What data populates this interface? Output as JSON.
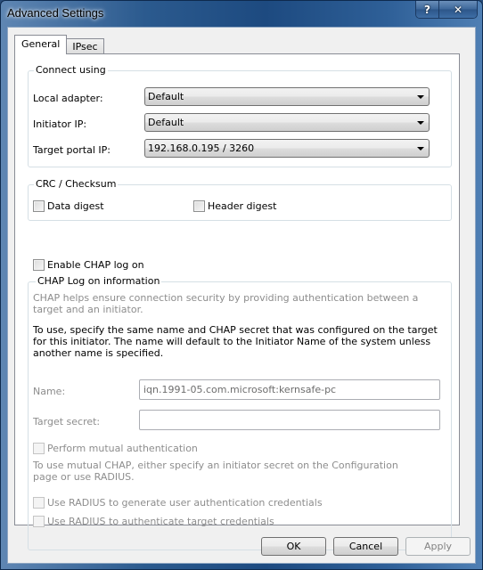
{
  "window": {
    "title": "Advanced Settings",
    "help_glyph": "?",
    "close_glyph": "✕"
  },
  "tabs": [
    {
      "label": "General",
      "active": true
    },
    {
      "label": "IPsec",
      "active": false
    }
  ],
  "connect_using": {
    "legend": "Connect using",
    "local_adapter": {
      "label": "Local adapter:",
      "value": "Default"
    },
    "initiator_ip": {
      "label": "Initiator IP:",
      "value": "Default"
    },
    "target_portal_ip": {
      "label": "Target portal IP:",
      "value": "192.168.0.195 / 3260"
    }
  },
  "crc": {
    "legend": "CRC / Checksum",
    "data_digest": {
      "label": "Data digest",
      "checked": false
    },
    "header_digest": {
      "label": "Header digest",
      "checked": false
    }
  },
  "enable_chap": {
    "label": "Enable CHAP log on",
    "checked": false
  },
  "chap": {
    "legend": "CHAP Log on information",
    "description": "CHAP helps ensure connection security by providing authentication between a target and an initiator.",
    "instructions": "To use, specify the same name and CHAP secret that was configured on the target for this initiator.  The name will default to the Initiator Name of the system unless another name is specified.",
    "name_label": "Name:",
    "name_value": "iqn.1991-05.com.microsoft:kernsafe-pc",
    "secret_label": "Target secret:",
    "secret_value": "",
    "mutual": {
      "label": "Perform mutual authentication",
      "checked": false
    },
    "mutual_note": "To use mutual CHAP, either specify an initiator secret on the Configuration page or use RADIUS.",
    "radius_generate": {
      "label": "Use RADIUS to generate user authentication credentials",
      "checked": false
    },
    "radius_authenticate": {
      "label": "Use RADIUS to authenticate target credentials",
      "checked": false
    }
  },
  "buttons": {
    "ok": "OK",
    "cancel": "Cancel",
    "apply": "Apply"
  }
}
